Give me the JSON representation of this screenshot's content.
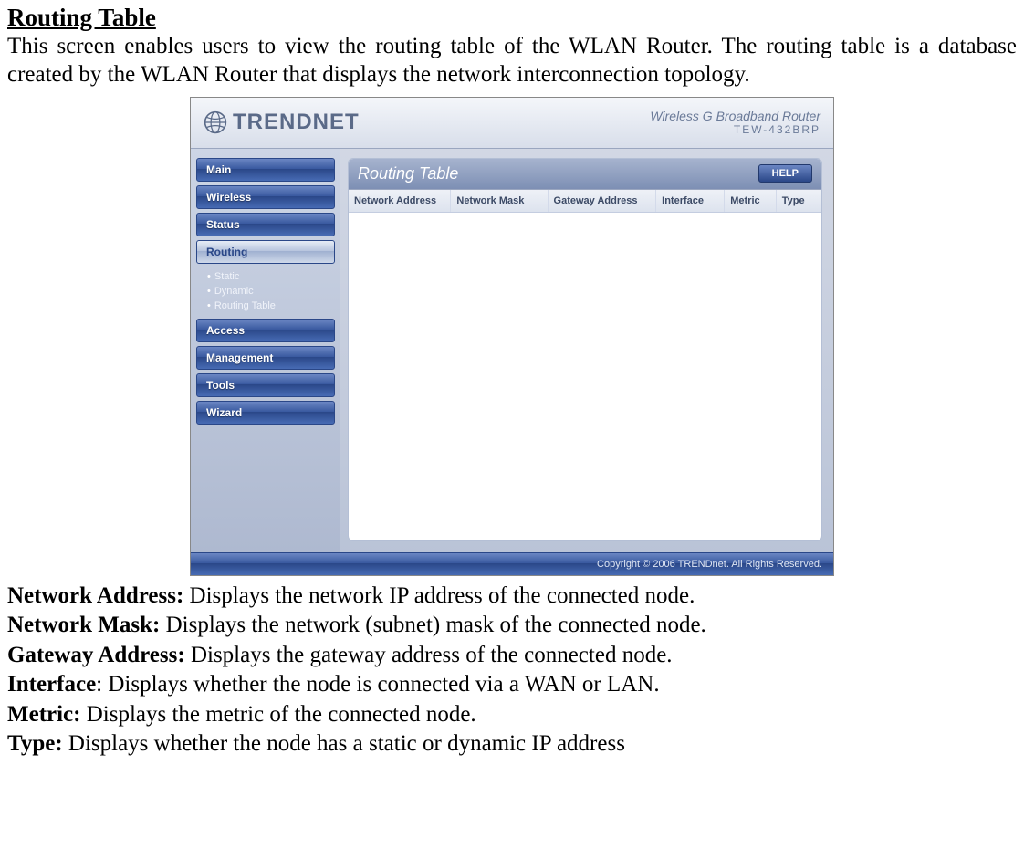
{
  "doc": {
    "title": "Routing Table",
    "intro": "This screen enables users to view the routing table of the WLAN Router. The routing table is a database created by the WLAN Router that displays the network interconnection topology.",
    "defs": [
      {
        "term": "Network Address:",
        "desc": " Displays the network IP address of the connected node."
      },
      {
        "term": "Network Mask:",
        "desc": " Displays the network (subnet) mask of the connected node."
      },
      {
        "term": "Gateway Address:",
        "desc": " Displays the gateway address of the connected node."
      },
      {
        "term": "Interface",
        "desc": ": Displays whether the node is connected via a WAN or LAN."
      },
      {
        "term": "Metric:",
        "desc": " Displays the metric of the connected node."
      },
      {
        "term": "Type:",
        "desc": " Displays whether the node has a static or dynamic IP address"
      }
    ]
  },
  "router": {
    "brand_upper": "TRENDNET",
    "product_line": "Wireless G Broadband Router",
    "model": "TEW-432BRP",
    "nav": {
      "items": [
        "Main",
        "Wireless",
        "Status",
        "Routing",
        "Access",
        "Management",
        "Tools",
        "Wizard"
      ],
      "active_index": 3,
      "sub": [
        "Static",
        "Dynamic",
        "Routing Table"
      ]
    },
    "panel": {
      "title": "Routing Table",
      "help_label": "HELP",
      "columns": [
        "Network Address",
        "Network Mask",
        "Gateway Address",
        "Interface",
        "Metric",
        "Type"
      ]
    },
    "footer": "Copyright © 2006 TRENDnet. All Rights Reserved."
  }
}
